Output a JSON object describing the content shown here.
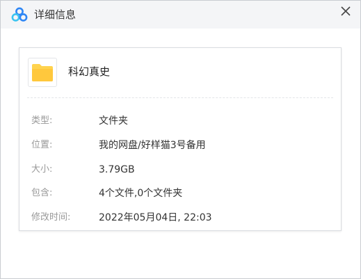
{
  "window": {
    "title": "详细信息",
    "logo_icon": "baidu-netdisk-logo-icon",
    "close_icon": "close-icon"
  },
  "item": {
    "icon": "folder-icon",
    "name": "科幻真史"
  },
  "details": [
    {
      "label": "类型:",
      "value": "文件夹"
    },
    {
      "label": "位置:",
      "value": "我的网盘/好样猫3号备用"
    },
    {
      "label": "大小:",
      "value": "3.79GB"
    },
    {
      "label": "包含:",
      "value": "4个文件,0个文件夹"
    },
    {
      "label": "修改时间:",
      "value": "2022年05月04日, 22:03"
    }
  ],
  "colors": {
    "folder": "#FFD34E",
    "logo_blue": "#2E86F5",
    "logo_cyan": "#3CC4F0"
  }
}
